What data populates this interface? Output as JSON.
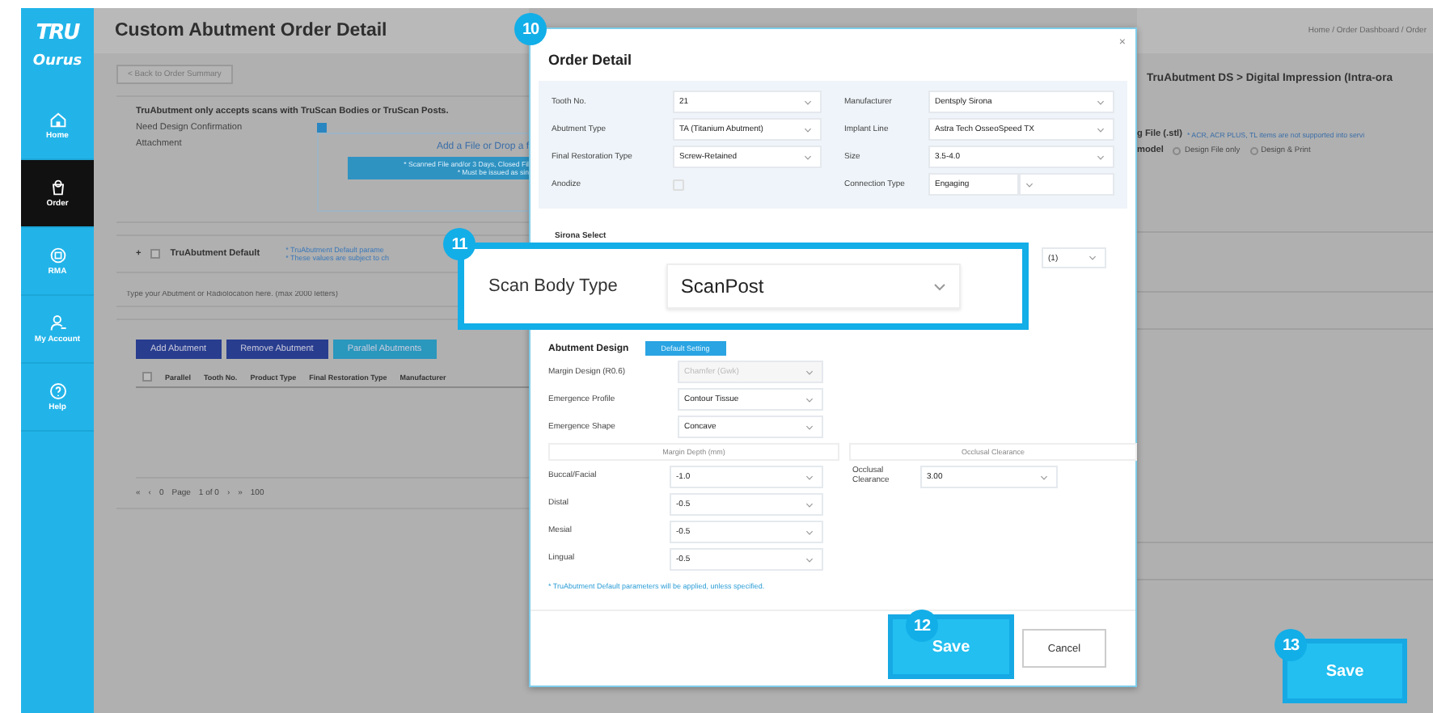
{
  "sidebar": {
    "logo_top": "TRU",
    "logo_bottom": "Ourus",
    "items": [
      {
        "label": "Home",
        "selected": false
      },
      {
        "label": "Order",
        "selected": true
      },
      {
        "label": "RMA",
        "selected": false
      },
      {
        "label": "My Account",
        "selected": false
      },
      {
        "label": "Help",
        "selected": false
      }
    ]
  },
  "page": {
    "title": "Custom Abutment Order Detail",
    "back_button": "< Back to Order Summary",
    "breadcrumb": "Home / Order Dashboard / Order",
    "notice": "TruAbutment only accepts scans with TruScan Bodies or TruScan Posts.",
    "design_confirmation": {
      "label": "Need Design Confirmation",
      "checked": true
    },
    "attachment": {
      "label": "Attachment",
      "drop_text": "Add a File or Drop a f",
      "notes": [
        "* Scanned File and/or 3 Days, Closed Fil",
        "* Must be issued as sin"
      ]
    },
    "default": {
      "expander": "+",
      "label": "TruAbutment Default",
      "checked": false,
      "notes": [
        "* TruAbutment Default parame",
        "* These values are subject to ch"
      ]
    },
    "comment": {
      "placeholder": "Type your Abutment or Radiolocation here. (max 2000 letters)"
    },
    "buttons": [
      {
        "label": "Add Abutment",
        "kind": "primary"
      },
      {
        "label": "Remove Abutment",
        "kind": "primary"
      },
      {
        "label": "Parallel Abutments",
        "kind": "secondary"
      }
    ],
    "table": {
      "select_all": false,
      "columns": [
        "Parallel",
        "Tooth No.",
        "Product Type",
        "Final Restoration Type",
        "Manufacturer"
      ]
    },
    "pagination": [
      "«",
      "‹",
      "0",
      "Page",
      "1 of 0",
      "›",
      "»",
      "100"
    ],
    "product": "TruAbutment DS > Digital Impression (Intra-ora",
    "scan_file": {
      "label": "g File (.stl)",
      "note": "* ACR, ACR PLUS, TL items are not supported into servi"
    },
    "model": {
      "label": "model",
      "options": [
        {
          "label": "Design File only",
          "selected": false
        },
        {
          "label": "Design & Print",
          "selected": false
        }
      ]
    },
    "save_button": "Save"
  },
  "modal": {
    "title": "Order Detail",
    "close": "×",
    "left_fields": [
      {
        "label": "Tooth No.",
        "value": "21",
        "kind": "select"
      },
      {
        "label": "Abutment Type",
        "value": "TA (Titanium Abutment)",
        "kind": "select"
      },
      {
        "label": "Final Restoration Type",
        "value": "Screw-Retained",
        "kind": "select"
      },
      {
        "label": "Anodize",
        "kind": "checkbox",
        "checked": false
      }
    ],
    "right_fields": [
      {
        "label": "Manufacturer",
        "value": "Dentsply Sirona"
      },
      {
        "label": "Implant Line",
        "value": "Astra Tech OsseoSpeed TX"
      },
      {
        "label": "Size",
        "value": "3.5-4.0"
      },
      {
        "label": "Connection Type",
        "value": "Engaging",
        "extra_select": true
      }
    ],
    "section_label": "Sirona Select",
    "section_value": "(1)",
    "design": {
      "title": "Abutment Design",
      "default_button": "Default Setting",
      "fields": [
        {
          "label": "Margin Design (R0.6)",
          "value": "Chamfer (Gwk)",
          "disabled": true
        },
        {
          "label": "Emergence Profile",
          "value": "Contour Tissue",
          "disabled": false
        },
        {
          "label": "Emergence Shape",
          "value": "Concave",
          "disabled": false
        }
      ],
      "margin_header": "Margin Depth (mm)",
      "occlusal_header": "Occlusal Clearance",
      "depths": [
        {
          "label": "Buccal/Facial",
          "value": "-1.0"
        },
        {
          "label": "Distal",
          "value": "-0.5"
        },
        {
          "label": "Mesial",
          "value": "-0.5"
        },
        {
          "label": "Lingual",
          "value": "-0.5"
        }
      ],
      "occlusal": {
        "label": "Occlusal Clearance",
        "value": "3.00"
      },
      "note": "* TruAbutment Default parameters will be applied, unless specified."
    },
    "save": "Save",
    "cancel": "Cancel"
  },
  "callout": {
    "label": "Scan Body Type",
    "value": "ScanPost"
  },
  "steps": [
    "10",
    "11",
    "12",
    "13"
  ]
}
